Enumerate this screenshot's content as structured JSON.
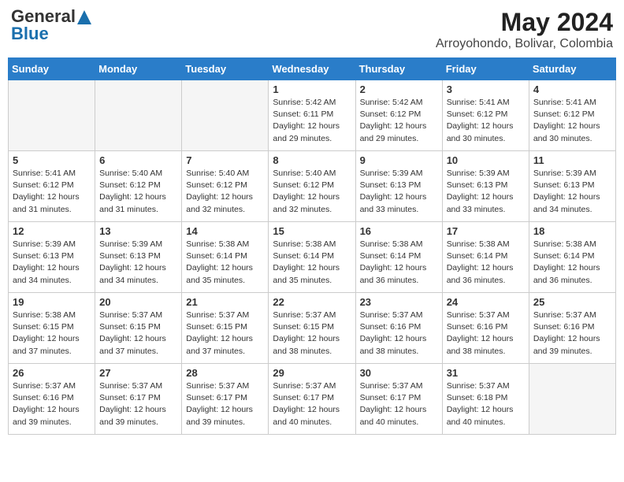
{
  "header": {
    "logo_general": "General",
    "logo_blue": "Blue",
    "title": "May 2024",
    "location": "Arroyohondo, Bolivar, Colombia"
  },
  "days_of_week": [
    "Sunday",
    "Monday",
    "Tuesday",
    "Wednesday",
    "Thursday",
    "Friday",
    "Saturday"
  ],
  "weeks": [
    [
      {
        "num": "",
        "info": ""
      },
      {
        "num": "",
        "info": ""
      },
      {
        "num": "",
        "info": ""
      },
      {
        "num": "1",
        "info": "Sunrise: 5:42 AM\nSunset: 6:11 PM\nDaylight: 12 hours\nand 29 minutes."
      },
      {
        "num": "2",
        "info": "Sunrise: 5:42 AM\nSunset: 6:12 PM\nDaylight: 12 hours\nand 29 minutes."
      },
      {
        "num": "3",
        "info": "Sunrise: 5:41 AM\nSunset: 6:12 PM\nDaylight: 12 hours\nand 30 minutes."
      },
      {
        "num": "4",
        "info": "Sunrise: 5:41 AM\nSunset: 6:12 PM\nDaylight: 12 hours\nand 30 minutes."
      }
    ],
    [
      {
        "num": "5",
        "info": "Sunrise: 5:41 AM\nSunset: 6:12 PM\nDaylight: 12 hours\nand 31 minutes."
      },
      {
        "num": "6",
        "info": "Sunrise: 5:40 AM\nSunset: 6:12 PM\nDaylight: 12 hours\nand 31 minutes."
      },
      {
        "num": "7",
        "info": "Sunrise: 5:40 AM\nSunset: 6:12 PM\nDaylight: 12 hours\nand 32 minutes."
      },
      {
        "num": "8",
        "info": "Sunrise: 5:40 AM\nSunset: 6:12 PM\nDaylight: 12 hours\nand 32 minutes."
      },
      {
        "num": "9",
        "info": "Sunrise: 5:39 AM\nSunset: 6:13 PM\nDaylight: 12 hours\nand 33 minutes."
      },
      {
        "num": "10",
        "info": "Sunrise: 5:39 AM\nSunset: 6:13 PM\nDaylight: 12 hours\nand 33 minutes."
      },
      {
        "num": "11",
        "info": "Sunrise: 5:39 AM\nSunset: 6:13 PM\nDaylight: 12 hours\nand 34 minutes."
      }
    ],
    [
      {
        "num": "12",
        "info": "Sunrise: 5:39 AM\nSunset: 6:13 PM\nDaylight: 12 hours\nand 34 minutes."
      },
      {
        "num": "13",
        "info": "Sunrise: 5:39 AM\nSunset: 6:13 PM\nDaylight: 12 hours\nand 34 minutes."
      },
      {
        "num": "14",
        "info": "Sunrise: 5:38 AM\nSunset: 6:14 PM\nDaylight: 12 hours\nand 35 minutes."
      },
      {
        "num": "15",
        "info": "Sunrise: 5:38 AM\nSunset: 6:14 PM\nDaylight: 12 hours\nand 35 minutes."
      },
      {
        "num": "16",
        "info": "Sunrise: 5:38 AM\nSunset: 6:14 PM\nDaylight: 12 hours\nand 36 minutes."
      },
      {
        "num": "17",
        "info": "Sunrise: 5:38 AM\nSunset: 6:14 PM\nDaylight: 12 hours\nand 36 minutes."
      },
      {
        "num": "18",
        "info": "Sunrise: 5:38 AM\nSunset: 6:14 PM\nDaylight: 12 hours\nand 36 minutes."
      }
    ],
    [
      {
        "num": "19",
        "info": "Sunrise: 5:38 AM\nSunset: 6:15 PM\nDaylight: 12 hours\nand 37 minutes."
      },
      {
        "num": "20",
        "info": "Sunrise: 5:37 AM\nSunset: 6:15 PM\nDaylight: 12 hours\nand 37 minutes."
      },
      {
        "num": "21",
        "info": "Sunrise: 5:37 AM\nSunset: 6:15 PM\nDaylight: 12 hours\nand 37 minutes."
      },
      {
        "num": "22",
        "info": "Sunrise: 5:37 AM\nSunset: 6:15 PM\nDaylight: 12 hours\nand 38 minutes."
      },
      {
        "num": "23",
        "info": "Sunrise: 5:37 AM\nSunset: 6:16 PM\nDaylight: 12 hours\nand 38 minutes."
      },
      {
        "num": "24",
        "info": "Sunrise: 5:37 AM\nSunset: 6:16 PM\nDaylight: 12 hours\nand 38 minutes."
      },
      {
        "num": "25",
        "info": "Sunrise: 5:37 AM\nSunset: 6:16 PM\nDaylight: 12 hours\nand 39 minutes."
      }
    ],
    [
      {
        "num": "26",
        "info": "Sunrise: 5:37 AM\nSunset: 6:16 PM\nDaylight: 12 hours\nand 39 minutes."
      },
      {
        "num": "27",
        "info": "Sunrise: 5:37 AM\nSunset: 6:17 PM\nDaylight: 12 hours\nand 39 minutes."
      },
      {
        "num": "28",
        "info": "Sunrise: 5:37 AM\nSunset: 6:17 PM\nDaylight: 12 hours\nand 39 minutes."
      },
      {
        "num": "29",
        "info": "Sunrise: 5:37 AM\nSunset: 6:17 PM\nDaylight: 12 hours\nand 40 minutes."
      },
      {
        "num": "30",
        "info": "Sunrise: 5:37 AM\nSunset: 6:17 PM\nDaylight: 12 hours\nand 40 minutes."
      },
      {
        "num": "31",
        "info": "Sunrise: 5:37 AM\nSunset: 6:18 PM\nDaylight: 12 hours\nand 40 minutes."
      },
      {
        "num": "",
        "info": ""
      }
    ]
  ]
}
